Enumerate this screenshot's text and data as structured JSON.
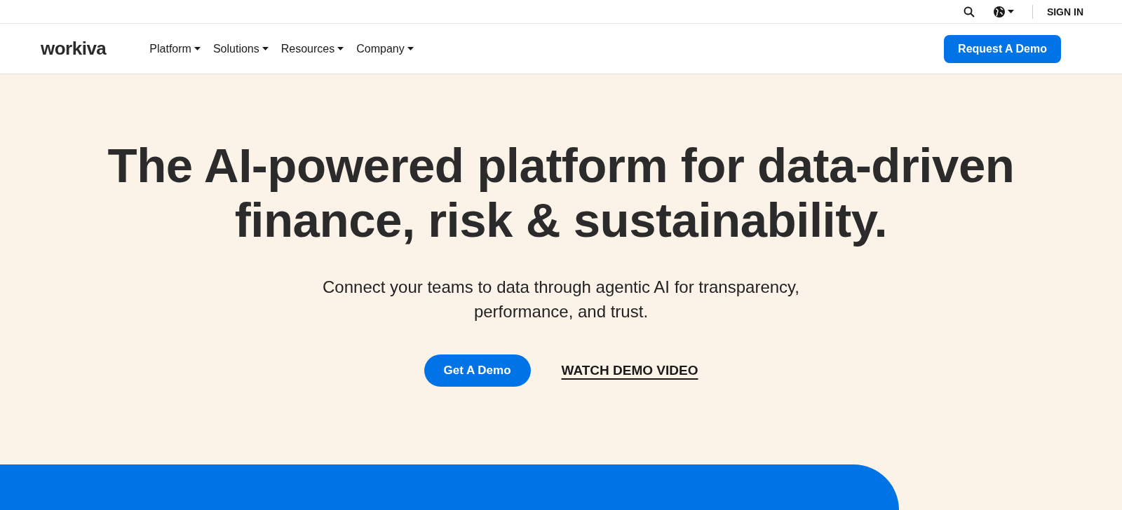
{
  "utility_bar": {
    "sign_in": "SIGN IN"
  },
  "nav": {
    "logo": "workiva",
    "items": [
      {
        "label": "Platform"
      },
      {
        "label": "Solutions"
      },
      {
        "label": "Resources"
      },
      {
        "label": "Company"
      }
    ],
    "cta": "Request A Demo"
  },
  "hero": {
    "headline": [
      "The AI-powered platform for data-driven",
      "finance, risk & sustainability."
    ],
    "subtitle": [
      "Connect your teams to data through agentic AI for transparency,",
      "performance, and trust."
    ],
    "primary_button": "Get A Demo",
    "link": "WATCH DEMO VIDEO"
  }
}
